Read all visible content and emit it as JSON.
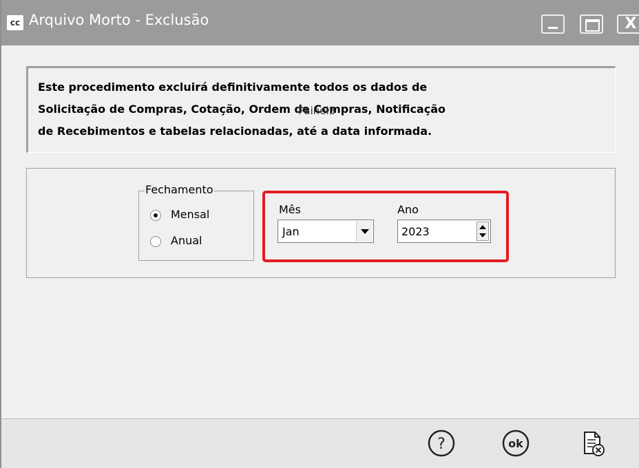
{
  "window": {
    "title": "Arquivo Morto - Exclusão",
    "app_icon_text": "cc",
    "controls": {
      "close_glyph": "X"
    }
  },
  "info": {
    "lines": [
      "Este procedimento excluirá definitivamente todos os dados de",
      "Solicitação de Compras, Cotação, Ordem de Compras, Notificação",
      "de Recebimentos e tabelas relacionadas, até a data informada."
    ],
    "overlay_label": "Painel3"
  },
  "fechamento": {
    "legend": "Fechamento",
    "options": [
      {
        "label": "Mensal",
        "checked": true
      },
      {
        "label": "Anual",
        "checked": false
      }
    ]
  },
  "periodo": {
    "mes_label": "Mês",
    "mes_value": "Jan",
    "ano_label": "Ano",
    "ano_value": "2023",
    "highlight_color": "#e31c23"
  },
  "footer": {
    "buttons": [
      {
        "icon": "help-icon"
      },
      {
        "icon": "ok-icon",
        "text": "ok"
      },
      {
        "icon": "cancel-document-icon"
      }
    ]
  }
}
